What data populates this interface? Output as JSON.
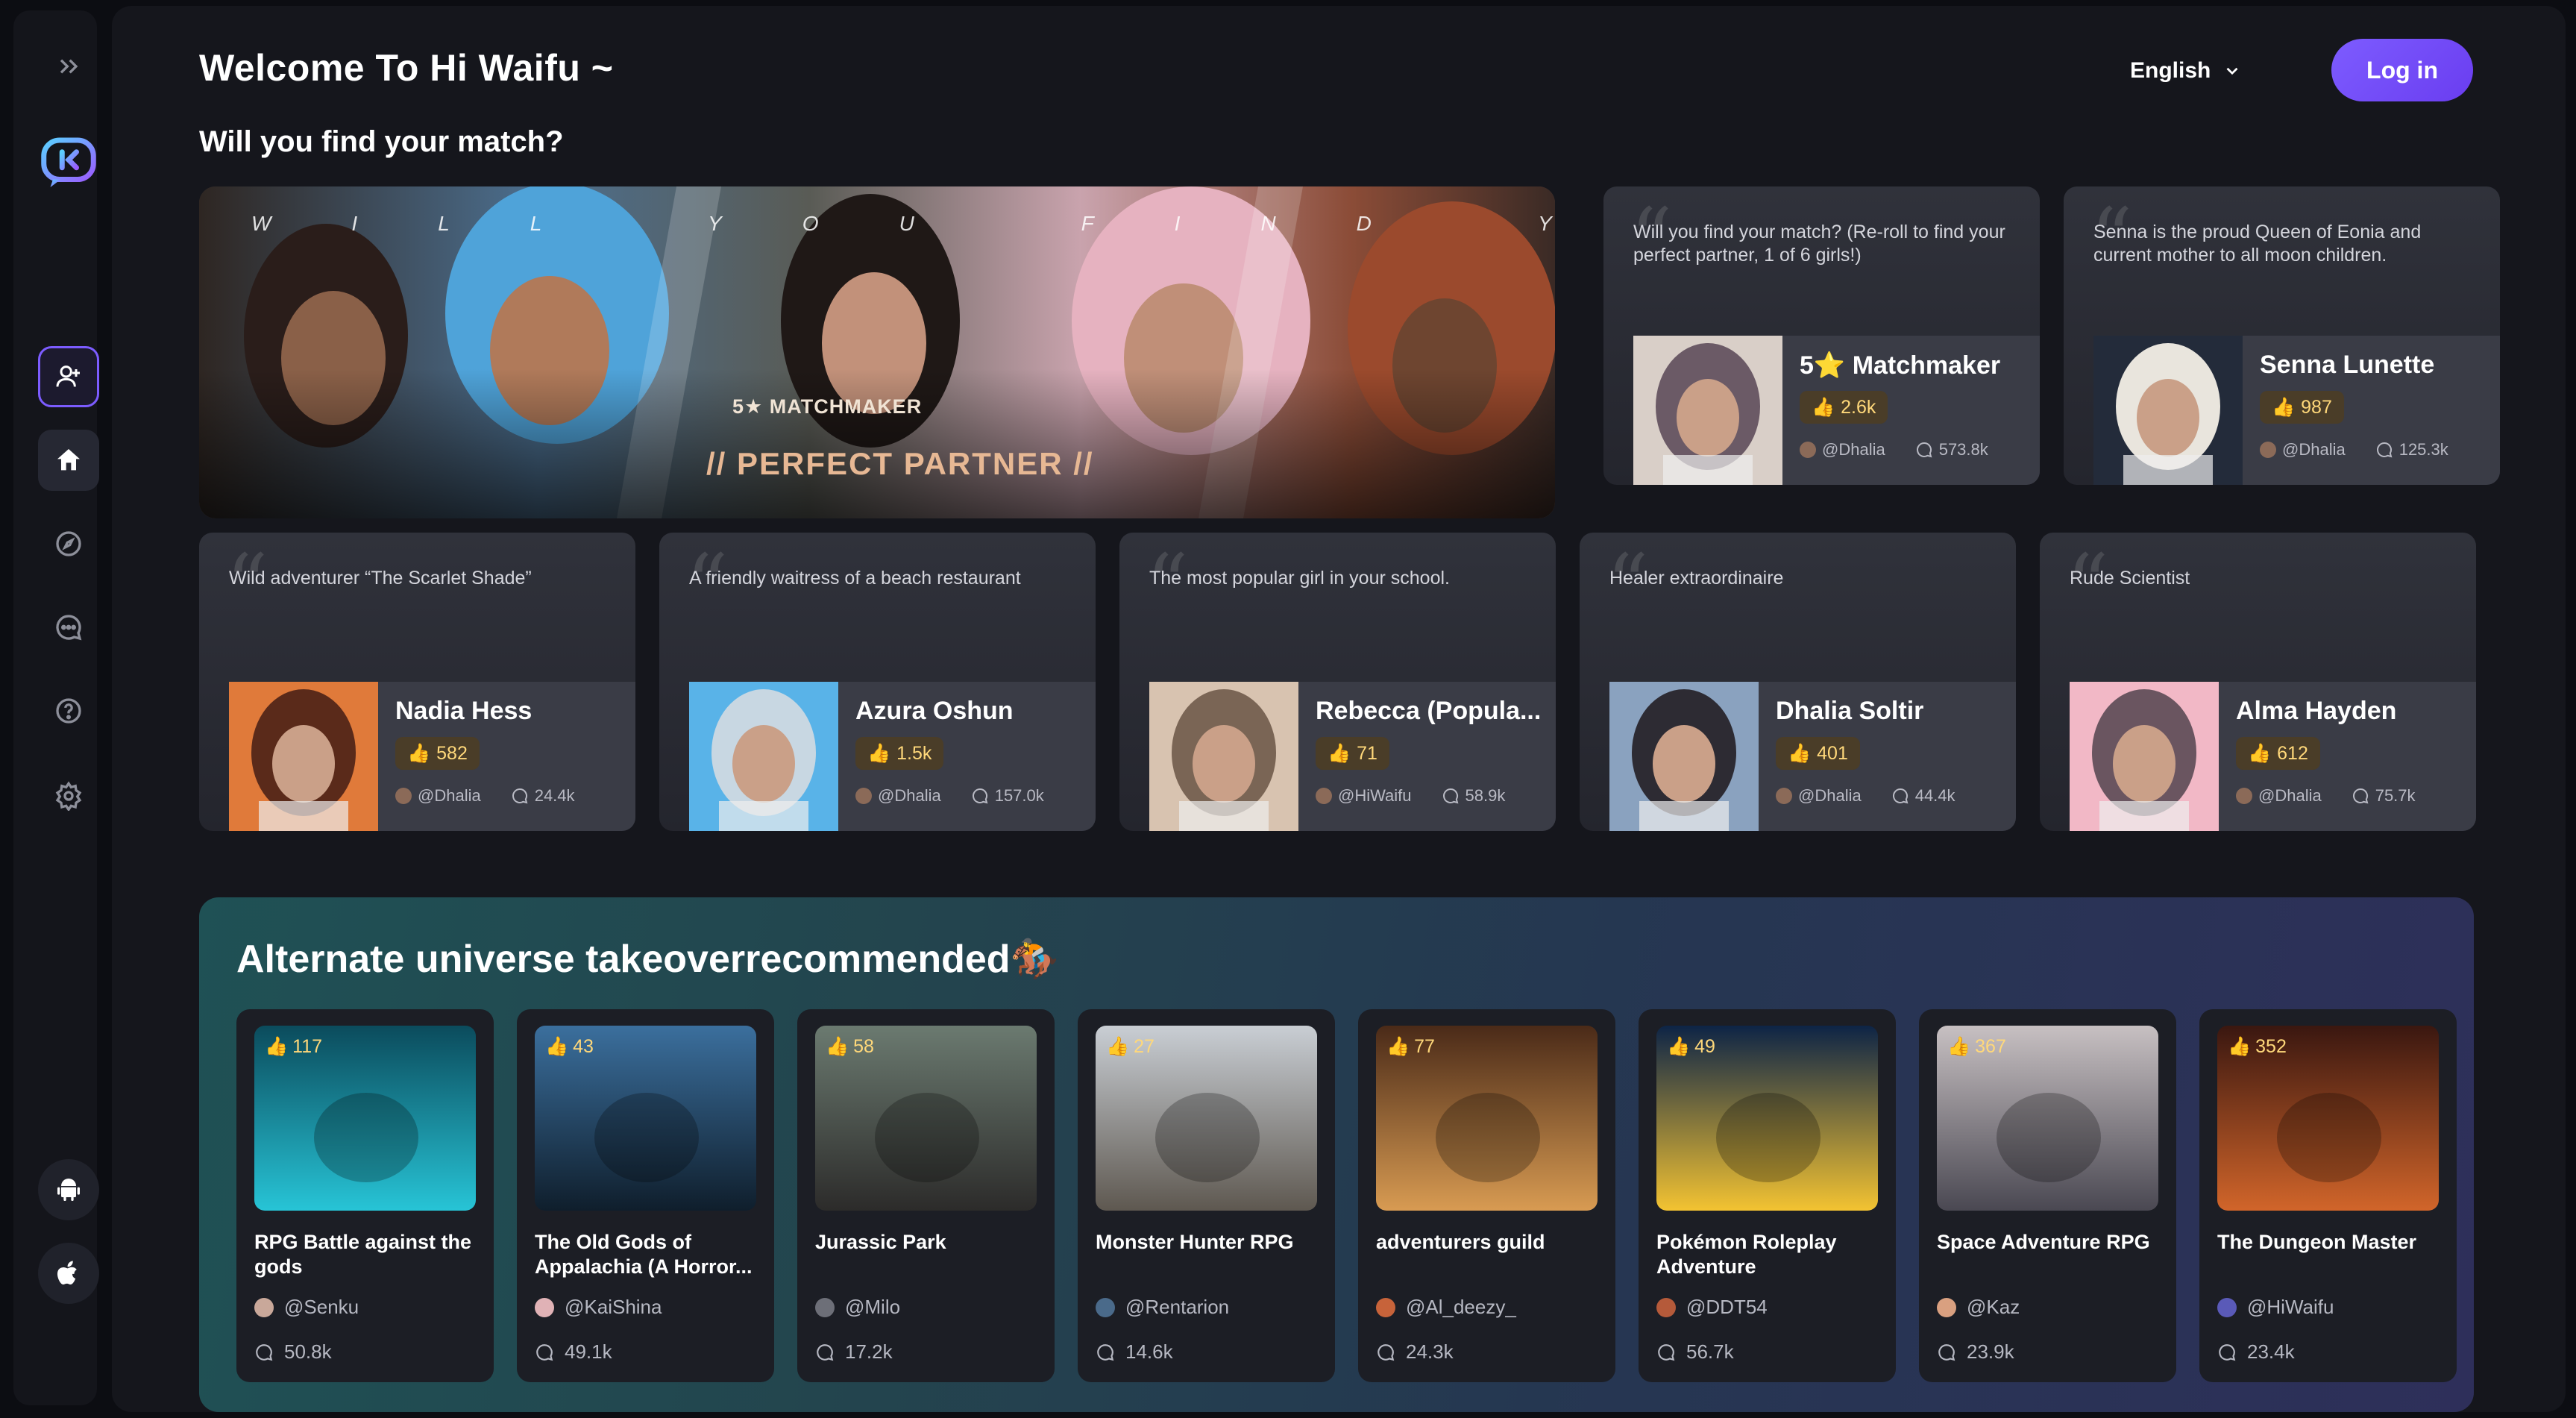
{
  "header": {
    "welcome": "Welcome To Hi Waifu ~",
    "language": "English",
    "login": "Log in",
    "subtitle": "Will you find your match?"
  },
  "sidebar": {
    "items": [
      "expand-icon",
      "app-logo",
      "add-character-icon",
      "home-icon",
      "discover-icon",
      "chat-icon",
      "help-icon",
      "settings-icon",
      "android-icon",
      "apple-icon"
    ]
  },
  "banner": {
    "tagline": "WILL YOU FIND YOUR MATCH",
    "subheading": "5★ MATCHMAKER",
    "title": "// PERFECT PARTNER //"
  },
  "characters": [
    {
      "desc": "Will you find your match? (Re-roll to find your perfect partner, 1 of 6 girls!)",
      "name": "5⭐ Matchmaker",
      "likes": "2.6k",
      "author": "@Dhalia",
      "chats": "573.8k"
    },
    {
      "desc": "Senna is the proud Queen of Eonia and current mother to all moon children.",
      "name": "Senna Lunette",
      "likes": "987",
      "author": "@Dhalia",
      "chats": "125.3k"
    },
    {
      "desc": "Wild adventurer “The Scarlet Shade”",
      "name": "Nadia Hess",
      "likes": "582",
      "author": "@Dhalia",
      "chats": "24.4k"
    },
    {
      "desc": "A friendly waitress of a beach restaurant",
      "name": "Azura Oshun",
      "likes": "1.5k",
      "author": "@Dhalia",
      "chats": "157.0k"
    },
    {
      "desc": "The most popular girl in your school.",
      "name": "Rebecca (Popula...",
      "likes": "71",
      "author": "@HiWaifu",
      "chats": "58.9k"
    },
    {
      "desc": "Healer extraordinaire",
      "name": "Dhalia Soltir",
      "likes": "401",
      "author": "@Dhalia",
      "chats": "44.4k"
    },
    {
      "desc": "Rude Scientist",
      "name": "Alma Hayden",
      "likes": "612",
      "author": "@Dhalia",
      "chats": "75.7k"
    }
  ],
  "section": {
    "title": "Alternate universe takeoverrecommended🏇"
  },
  "games": [
    {
      "likes": "117",
      "name": "RPG Battle against the gods",
      "author": "@Senku",
      "chats": "50.8k"
    },
    {
      "likes": "43",
      "name": "The Old Gods of Appalachia (A Horror...",
      "author": "@KaiShina",
      "chats": "49.1k"
    },
    {
      "likes": "58",
      "name": "Jurassic Park",
      "author": "@Milo",
      "chats": "17.2k"
    },
    {
      "likes": "27",
      "name": "Monster Hunter RPG",
      "author": "@Rentarion",
      "chats": "14.6k"
    },
    {
      "likes": "77",
      "name": "adventurers guild",
      "author": "@Al_deezy_",
      "chats": "24.3k"
    },
    {
      "likes": "49",
      "name": "Pokémon Roleplay Adventure",
      "author": "@DDT54",
      "chats": "56.7k"
    },
    {
      "likes": "367",
      "name": "Space Adventure RPG",
      "author": "@Kaz",
      "chats": "23.9k"
    },
    {
      "likes": "352",
      "name": "The Dungeon Master",
      "author": "@HiWaifu",
      "chats": "23.4k"
    }
  ],
  "colors": {
    "accent": "#7c5cff",
    "like": "#ffd87a",
    "background": "#15161c"
  }
}
